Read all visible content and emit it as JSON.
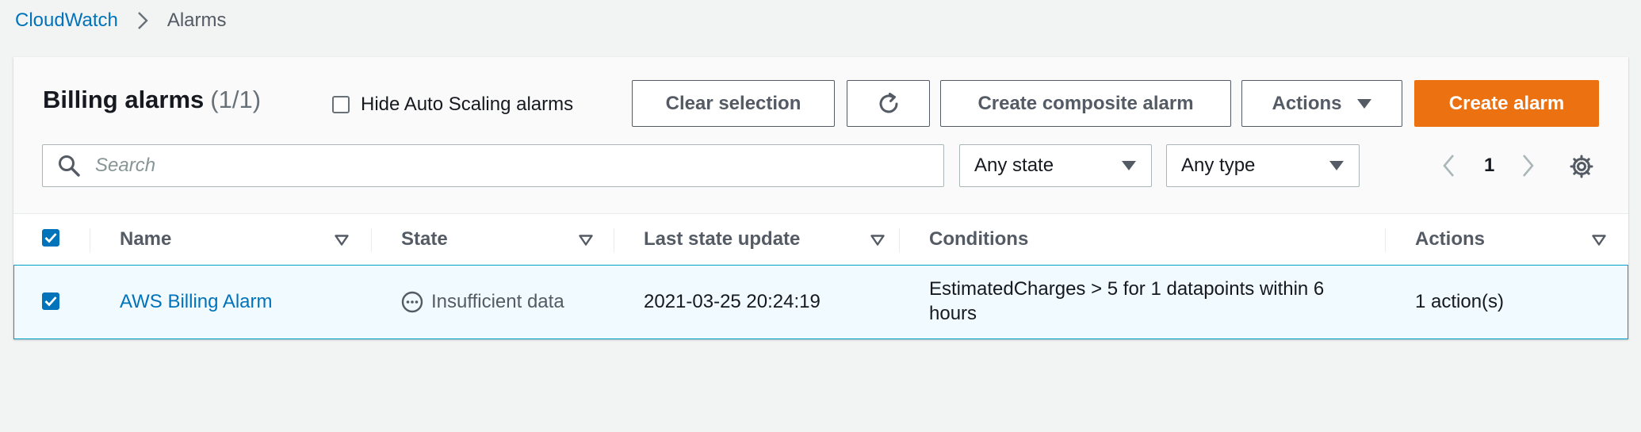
{
  "breadcrumb": {
    "root": "CloudWatch",
    "current": "Alarms"
  },
  "header": {
    "title": "Billing alarms",
    "count": "(1/1)",
    "hide_autoscaling_label": "Hide Auto Scaling alarms",
    "hide_autoscaling_checked": false
  },
  "toolbar": {
    "clear_selection": "Clear selection",
    "refresh_icon": "refresh-icon",
    "create_composite": "Create composite alarm",
    "actions": "Actions",
    "create_alarm": "Create alarm"
  },
  "filters": {
    "search_placeholder": "Search",
    "state_selected": "Any state",
    "type_selected": "Any type"
  },
  "pagination": {
    "current_page": "1"
  },
  "table": {
    "columns": [
      "Name",
      "State",
      "Last state update",
      "Conditions",
      "Actions"
    ],
    "rows": [
      {
        "selected": true,
        "name": "AWS Billing Alarm",
        "state": "Insufficient data",
        "last_update": "2021-03-25 20:24:19",
        "condition_line1": "EstimatedCharges > 5 for 1 datapoints within 6",
        "condition_line2": "hours",
        "actions": "1 action(s)"
      }
    ]
  },
  "colors": {
    "link": "#0073bb",
    "primary": "#ec7211",
    "selected_row_bg": "#f1faff",
    "selected_row_border": "#00a1c9"
  }
}
